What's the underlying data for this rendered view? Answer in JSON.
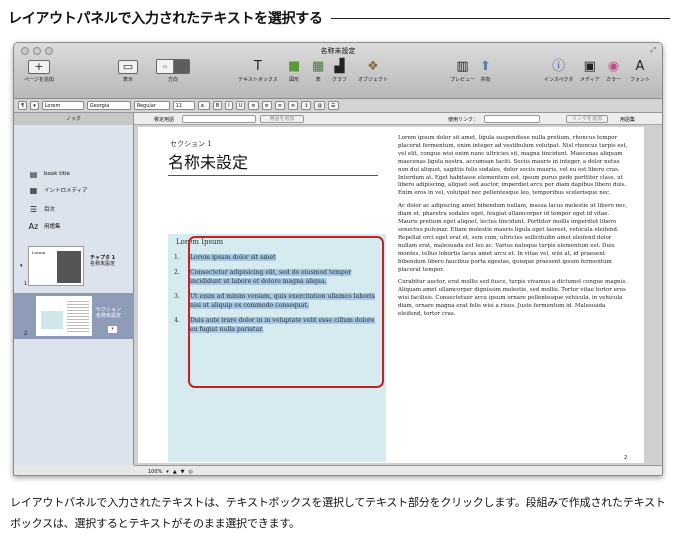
{
  "heading": "レイアウトパネルで入力されたテキストを選択する",
  "caption": "レイアウトパネルで入力されたテキストは、テキストボックスを選択してテキスト部分をクリックします。段組みで作成されたテキストボックスは、選択するとテキストがそのまま選択できます。",
  "window": {
    "title": "名称未設定"
  },
  "toolbar": {
    "add_page": "ページを追加",
    "view": "表示",
    "mode": "方向",
    "textbox": "テキストボックス",
    "shapes": "図形",
    "table": "表",
    "chart": "グラフ",
    "objects": "オブジェクト",
    "preview": "プレビュー",
    "share": "共有",
    "inspector": "インスペクタ",
    "media": "メディア",
    "colors": "カラー",
    "fonts": "フォント"
  },
  "format_bar": {
    "style": "Lorem",
    "font": "Georgia",
    "weight": "Regular",
    "size": "11"
  },
  "link_bar": {
    "tab": "ノック",
    "bookmark_label": "移定用語",
    "bookmark_button": "用語を追加",
    "link_label": "使用リンク：",
    "link_button": "リンクを追加",
    "glossary": "用語集"
  },
  "sidebar": {
    "items": [
      {
        "label": "book title",
        "icon": "book-icon"
      },
      {
        "label": "イントロメディア",
        "icon": "media-icon"
      },
      {
        "label": "目次",
        "icon": "list-icon"
      },
      {
        "label": "用語集",
        "icon": "glossary-icon"
      }
    ],
    "chapter_title": "チャプタ 1",
    "chapter_sub": "名称未設定",
    "chapter_thumb_text": "Lorem",
    "section_title": "セクション",
    "section_sub": "名称未設定",
    "page_num_1": "1",
    "page_num_2": "2"
  },
  "page": {
    "section_label": "セクション 1",
    "title": "名称未設定",
    "lorem_heading": "Lorem Ipsum",
    "items": [
      {
        "num": "1.",
        "text": "Lorem ipsum dolor sit amet"
      },
      {
        "num": "2.",
        "text": "Consectetur adipisicing elit, sed do eiusmod tempor incididunt ut labore et dolore magna aliqua."
      },
      {
        "num": "3.",
        "text": "Ut enim ad minim veniam, quis exercitation ullamco laboris nisi ut aliquip ex commodo consequat."
      },
      {
        "num": "4.",
        "text": "Duis aute irure dolor in in voluptate velit esse cillum dolore eu fugiat nulla pariatur."
      }
    ],
    "paragraphs": [
      "Lorem ipsum dolor sit amet, ligula suspendisse nulla pretium, rhoncus tempor placerat fermentum, enim integer ad vestibulum volutpat. Nisl rhoncus turpis est, vel elit, congue wisi enim nunc ultricies sit, magna tincidunt. Maecenas aliquam maecenas ligula nostra, accumsan taciti. Sociis mauris in integer, a dolor netus non dui aliquet, sagittis felis sodales, dolor sociis mauris, vel eu est libero cras. Interdum at. Eget habitasse elementum est, ipsum purus pede porttitor class, ut libero adipiscing, aliquet sed auctor, imperdiet arcu per diam dapibus libero duis. Enim eros in vel, volutpat nec pellentesque leo, temporibus scelerisque nec.",
      "Ac dolor ac adipiscing amet bibendum nullam, massa lacus molestie ut libero nec, diam et, pharetra sodales eget, feugiat ullamcorper id tempor eget id vitae. Mauris pretium eget aliquet, lectus tincidunt. Porttitor mollis imperdiet libero senectus pulvinar. Etiam molestie mauris ligula eget laoreet, vehicula eleifend. Repellat orci eget erat et, sem cum, ultricies sollicitudin amet eleifend dolor nullam erat, malesuada est leo ac. Varius natoque turpis elementum est. Duis montes, tellus lobortis lacus amet arcu et. In vitae vel, wisi at, id praesent bibendum libero faucibus porta egestas, quisque praesent ipsum fermentum placerat tempor.",
      "Curabitur auctor, erat mollis sed fusce, turpis vivamus a dictumst congue magnis. Aliquam amet ullamcorper dignissim molestie, sed mollis. Tortor vitae tortor eros wisi facilisis. Consectetuer arcu ipsum ornare pellentesque vehicula, in vehicula diam, ornare magna erat felis wisi a risus. Justo fermentum id. Malesuada eleifend, tortor cras."
    ],
    "page_number": "2"
  },
  "status_bar": {
    "zoom": "100%"
  }
}
